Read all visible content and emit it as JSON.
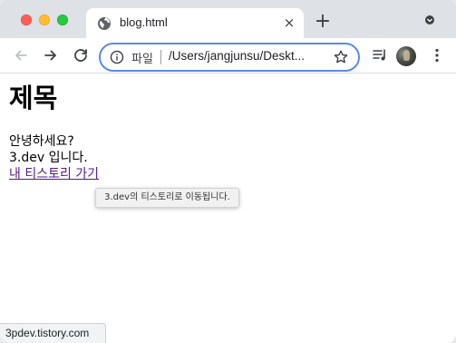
{
  "window": {
    "tab": {
      "title": "blog.html",
      "close_label": "×",
      "new_tab_label": "+"
    }
  },
  "toolbar": {
    "security_label": "파일",
    "url": "/Users/jangjunsu/Deskt...",
    "accent_color": "#5b89e6"
  },
  "page": {
    "heading": "제목",
    "lines": [
      "안녕하세요?",
      "3.dev 입니다."
    ],
    "link_text": "내 티스토리 가기",
    "link_color": "#551a8b",
    "tooltip": "3.dev의 티스토리로 이동됩니다."
  },
  "status": {
    "url": "3pdev.tistory.com"
  },
  "icons": {
    "tab": "globe-icon",
    "tab_close": "close-icon",
    "new_tab": "plus-icon",
    "tab_search": "chevron-down-icon",
    "back": "arrow-left-icon",
    "forward": "arrow-right-icon",
    "reload": "reload-icon",
    "info": "info-icon",
    "bookmark": "star-icon",
    "reading_list": "reading-list-icon",
    "profile": "avatar",
    "menu": "kebab-menu-icon"
  }
}
